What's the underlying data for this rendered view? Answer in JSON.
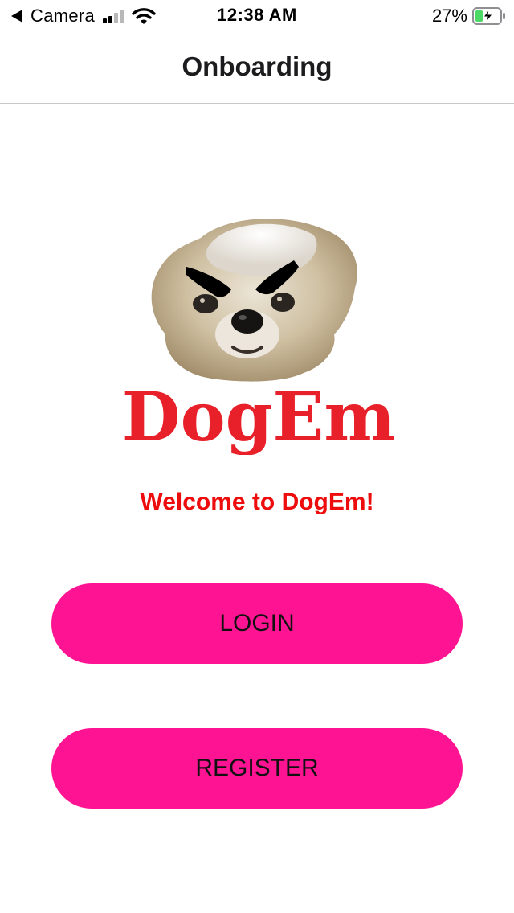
{
  "status_bar": {
    "back_app": "Camera",
    "time": "12:38 AM",
    "battery_percent": "27%",
    "battery_level": 0.27,
    "charging": true,
    "signal_bars_active": 2,
    "signal_bars_total": 4,
    "icons": [
      "back-triangle-icon",
      "cellular-signal-icon",
      "wifi-icon",
      "battery-charging-icon"
    ]
  },
  "nav": {
    "title": "Onboarding"
  },
  "logo": {
    "wordmark": "DogEm",
    "icon": "dog-face-logo"
  },
  "main": {
    "welcome": "Welcome to DogEm!"
  },
  "buttons": {
    "login": "LOGIN",
    "register": "REGISTER"
  },
  "colors": {
    "accent": "#fe1493",
    "welcome_text": "#ee0d0d",
    "logo_red": "#e8202a",
    "battery_green": "#4cd964"
  }
}
